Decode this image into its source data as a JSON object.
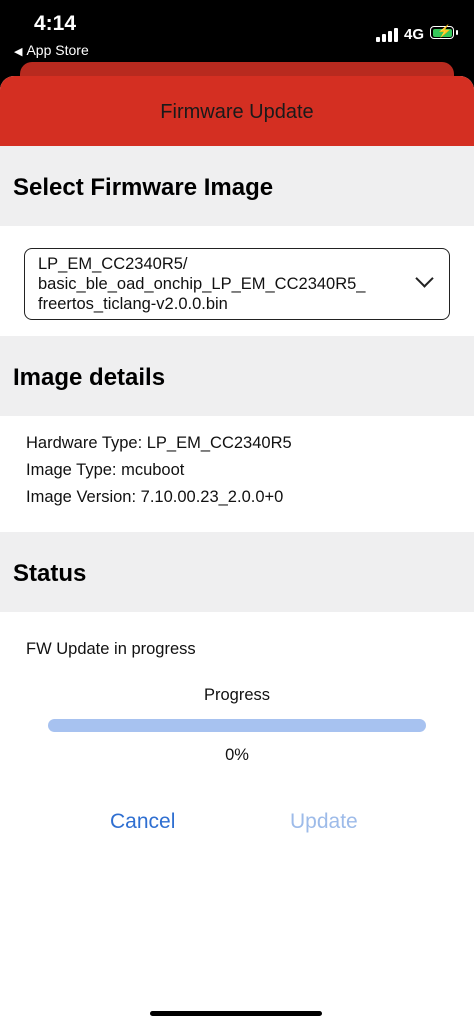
{
  "status_bar": {
    "time": "4:14",
    "back_label": "App Store",
    "network": "4G",
    "battery_color": "#35c759"
  },
  "nav": {
    "title": "Firmware Update",
    "background": "#d42f22"
  },
  "select_section": {
    "header": "Select Firmware Image",
    "selected_value": "LP_EM_CC2340R5/ basic_ble_oad_onchip_LP_EM_CC2340R5_ freertos_ticlang-v2.0.0.bin"
  },
  "details_section": {
    "header": "Image details",
    "hardware_type": "Hardware Type: LP_EM_CC2340R5",
    "image_type": "Image Type: mcuboot",
    "image_version": "Image Version: 7.10.00.23_2.0.0+0"
  },
  "status_section": {
    "header": "Status",
    "status_text": "FW Update in progress",
    "progress_label": "Progress",
    "progress_value": 0,
    "progress_text": "0%"
  },
  "actions": {
    "cancel_label": "Cancel",
    "update_label": "Update",
    "update_enabled": false
  }
}
